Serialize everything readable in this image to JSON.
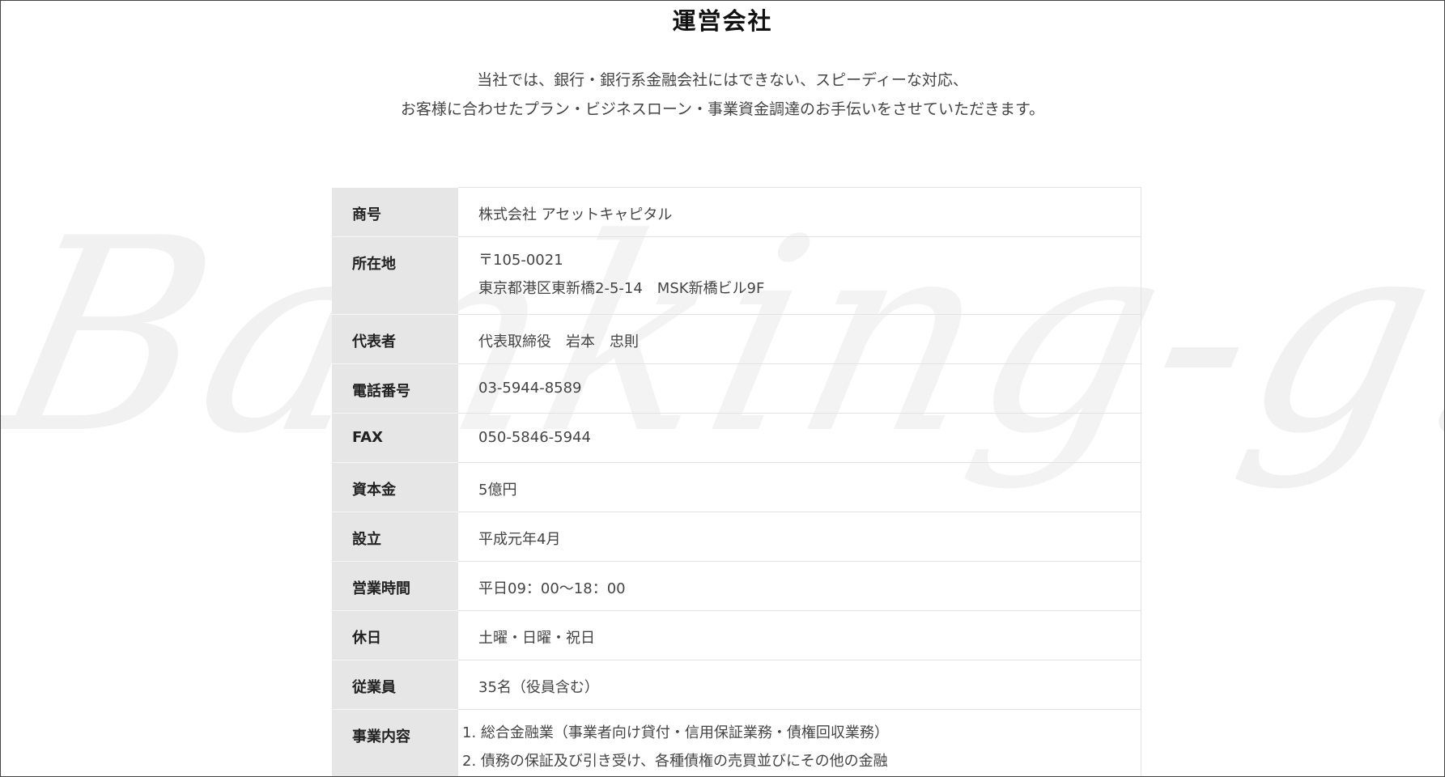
{
  "watermark": "Banking-g.com",
  "title": "運営会社",
  "intro": {
    "line1": "当社では、銀行・銀行系金融会社にはできない、スピーディーな対応、",
    "line2": "お客様に合わせたプラン・ビジネスローン・事業資金調達のお手伝いをさせていただきます。"
  },
  "company": {
    "trade_name": {
      "label": "商号",
      "value": "株式会社 アセットキャピタル"
    },
    "address": {
      "label": "所在地",
      "postal": "〒105-0021",
      "street": "東京都港区東新橋2-5-14　MSK新橋ビル9F"
    },
    "representative": {
      "label": "代表者",
      "value": "代表取締役　岩本　忠則"
    },
    "phone": {
      "label": "電話番号",
      "value": "03-5944-8589"
    },
    "fax": {
      "label": "FAX",
      "value": "050-5846-5944"
    },
    "capital": {
      "label": "資本金",
      "value": "5億円"
    },
    "established": {
      "label": "設立",
      "value": "平成元年4月"
    },
    "hours": {
      "label": "営業時間",
      "value": "平日09：00〜18：00"
    },
    "holidays": {
      "label": "休日",
      "value": "土曜・日曜・祝日"
    },
    "employees": {
      "label": "従業員",
      "value": "35名（役員含む）"
    },
    "business": {
      "label": "事業内容",
      "items": [
        "1. 総合金融業（事業者向け貸付・信用保証業務・債権回収業務）",
        "2. 債務の保証及び引き受け、各種債権の売買並びにその他の金融"
      ]
    }
  }
}
